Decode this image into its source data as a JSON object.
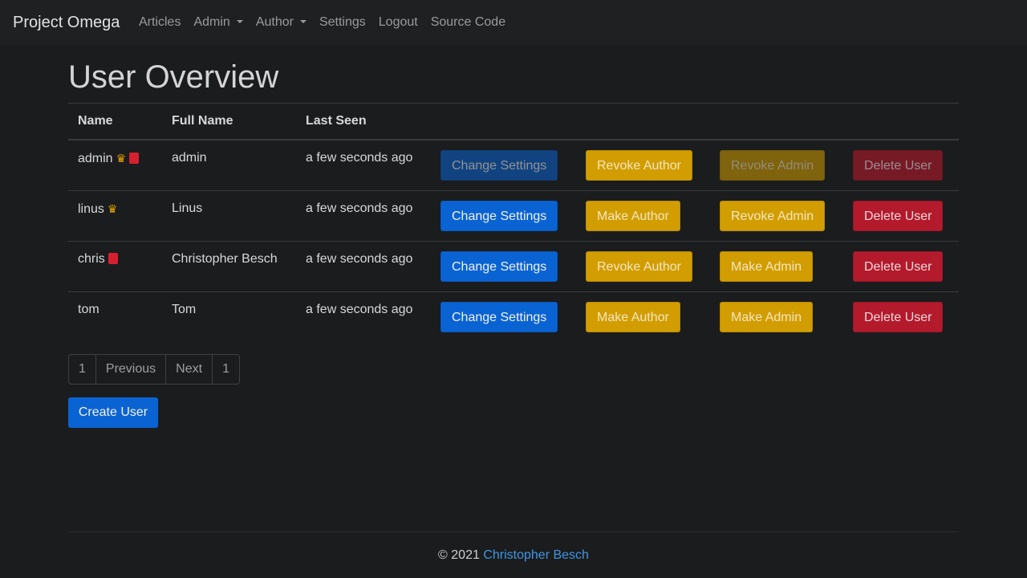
{
  "nav": {
    "brand": "Project Omega",
    "links": [
      "Articles",
      "Admin",
      "Author",
      "Settings",
      "Logout",
      "Source Code"
    ]
  },
  "page_title": "User Overview",
  "table": {
    "headers": [
      "Name",
      "Full Name",
      "Last Seen"
    ],
    "rows": [
      {
        "name": "admin",
        "badges": [
          "crown-icon",
          "book-icon"
        ],
        "full_name": "admin",
        "last_seen": "a few seconds ago",
        "actions": [
          "Change Settings",
          "Revoke Author",
          "Revoke Admin",
          "Delete User"
        ],
        "disabled": true
      },
      {
        "name": "linus",
        "badges": [
          "crown-icon"
        ],
        "full_name": "Linus",
        "last_seen": "a few seconds ago",
        "actions": [
          "Change Settings",
          "Make Author",
          "Revoke Admin",
          "Delete User"
        ],
        "disabled": false
      },
      {
        "name": "chris",
        "badges": [
          "book-icon"
        ],
        "full_name": "Christopher Besch",
        "last_seen": "a few seconds ago",
        "actions": [
          "Change Settings",
          "Revoke Author",
          "Make Admin",
          "Delete User"
        ],
        "disabled": false
      },
      {
        "name": "tom",
        "badges": [],
        "full_name": "Tom",
        "last_seen": "a few seconds ago",
        "actions": [
          "Change Settings",
          "Make Author",
          "Make Admin",
          "Delete User"
        ],
        "disabled": false
      }
    ]
  },
  "pagination": [
    "1",
    "Previous",
    "Next",
    "1"
  ],
  "create_button": "Create User",
  "footer": {
    "prefix": "© 2021",
    "author": "Christopher Besch"
  },
  "colors": {
    "background": "#1b1c1e",
    "primary": "#0a63d3",
    "warning": "#d29d00",
    "danger": "#b31a2c",
    "link": "#3f95e4"
  }
}
